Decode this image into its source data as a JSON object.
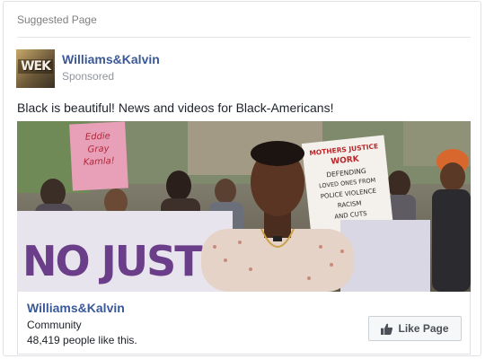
{
  "header": {
    "section_title": "Suggested Page"
  },
  "ad": {
    "page_name": "Williams&Kalvin",
    "sponsored_label": "Sponsored",
    "avatar_text": "WEK",
    "body_text": "Black is beautiful! News and videos for Black-Americans!",
    "media": {
      "sign_left": [
        "Eddie",
        "Gray",
        "Kamla!"
      ],
      "sign_right": [
        "MOTHERS JUSTICE",
        "WORK",
        "DEFENDING",
        "LOVED ONES FROM",
        "POLICE VIOLENCE",
        "RACISM",
        "AND CUTS"
      ],
      "banner_text": "NO JUSTICE"
    }
  },
  "footer": {
    "page_name": "Williams&Kalvin",
    "category": "Community",
    "likes_text": "48,419 people like this.",
    "like_button_label": "Like Page"
  },
  "colors": {
    "link_blue": "#3b5998",
    "muted_text": "#90949c",
    "border": "#dfe1e5",
    "button_bg": "#f6f7f9"
  },
  "icons": {
    "like_button_icon": "thumbs-up-icon"
  }
}
